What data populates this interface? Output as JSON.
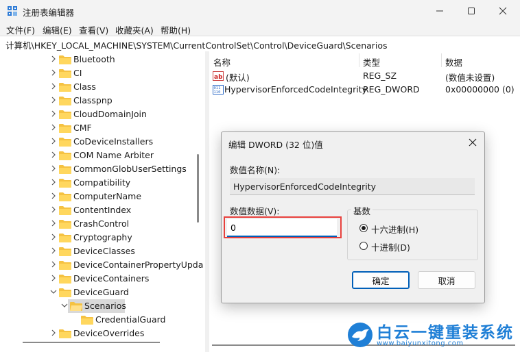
{
  "window": {
    "title": "注册表编辑器"
  },
  "menu": [
    "文件(F)",
    "编辑(E)",
    "查看(V)",
    "收藏夹(A)",
    "帮助(H)"
  ],
  "address": "计算机\\HKEY_LOCAL_MACHINE\\SYSTEM\\CurrentControlSet\\Control\\DeviceGuard\\Scenarios",
  "tree": [
    {
      "label": "Bluetooth"
    },
    {
      "label": "CI"
    },
    {
      "label": "Class"
    },
    {
      "label": "Classpnp"
    },
    {
      "label": "CloudDomainJoin"
    },
    {
      "label": "CMF"
    },
    {
      "label": "CoDeviceInstallers"
    },
    {
      "label": "COM Name Arbiter"
    },
    {
      "label": "CommonGlobUserSettings"
    },
    {
      "label": "Compatibility"
    },
    {
      "label": "ComputerName"
    },
    {
      "label": "ContentIndex"
    },
    {
      "label": "CrashControl"
    },
    {
      "label": "Cryptography"
    },
    {
      "label": "DeviceClasses"
    },
    {
      "label": "DeviceContainerPropertyUpda"
    },
    {
      "label": "DeviceContainers"
    },
    {
      "label": "DeviceGuard"
    },
    {
      "label": "Scenarios"
    },
    {
      "label": "CredentialGuard"
    },
    {
      "label": "DeviceOverrides"
    }
  ],
  "columns": {
    "name": "名称",
    "type": "类型",
    "data": "数据"
  },
  "values": [
    {
      "name": "(默认)",
      "type": "REG_SZ",
      "data": "(数值未设置)",
      "icon": "string-value-icon"
    },
    {
      "name": "HypervisorEnforcedCodeIntegrity",
      "type": "REG_DWORD",
      "data": "0x00000000 (0)",
      "icon": "binary-value-icon"
    }
  ],
  "dialog": {
    "title": "编辑 DWORD (32 位)值",
    "name_label": "数值名称(N):",
    "name_value": "HypervisorEnforcedCodeIntegrity",
    "data_label": "数值数据(V):",
    "data_value": "0",
    "base_label": "基数",
    "hex_label": "十六进制(H)",
    "dec_label": "十进制(D)",
    "base_selected": "hex",
    "ok": "确定",
    "cancel": "取消"
  },
  "watermark": {
    "text": "白云一键重装系统",
    "url": "www.baiyunxitong.com"
  },
  "colors": {
    "accent": "#005fb8",
    "highlight": "#e8403c",
    "folder": "#f5c242",
    "watermark": "#1f7fd6"
  }
}
